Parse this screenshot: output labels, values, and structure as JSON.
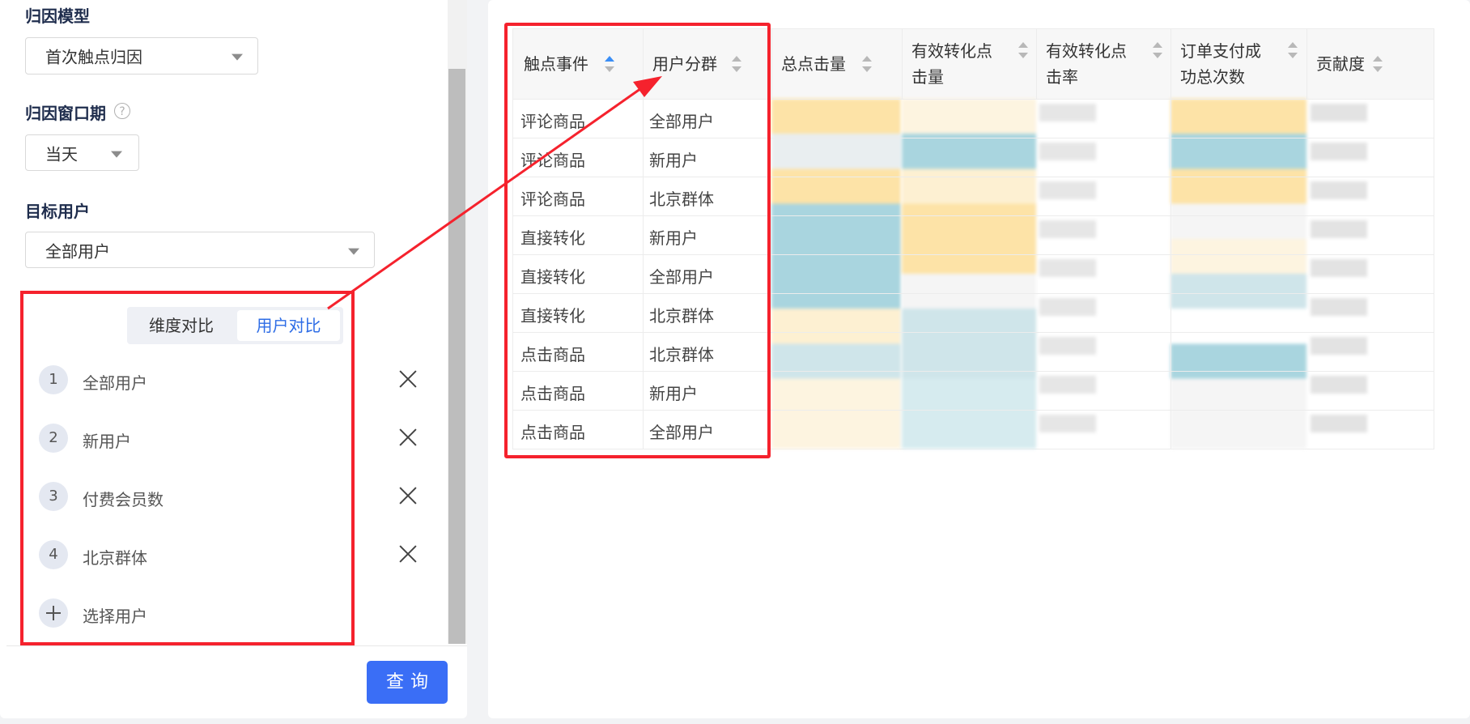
{
  "left": {
    "attribution_model_label": "归因模型",
    "attribution_model_value": "首次触点归因",
    "window_label": "归因窗口期",
    "window_help": "?",
    "window_value": "当天",
    "target_label": "目标用户",
    "target_value": "全部用户",
    "tabs": [
      {
        "label": "维度对比",
        "active": false
      },
      {
        "label": "用户对比",
        "active": true
      }
    ],
    "users": [
      {
        "num": "1",
        "name": "全部用户"
      },
      {
        "num": "2",
        "name": "新用户"
      },
      {
        "num": "3",
        "name": "付费会员数"
      },
      {
        "num": "4",
        "name": "北京群体"
      }
    ],
    "add_user_label": "选择用户",
    "query_button": "查询"
  },
  "table": {
    "columns": [
      {
        "label": "触点事件",
        "sort": "asc"
      },
      {
        "label": "用户分群",
        "sort": "none"
      },
      {
        "label": "总点击量",
        "sort": "none"
      },
      {
        "label": "有效转化点击量",
        "sort": "none"
      },
      {
        "label": "有效转化点击率",
        "sort": "none"
      },
      {
        "label": "订单支付成功总次数",
        "sort": "none"
      },
      {
        "label": "贡献度",
        "sort": "none"
      }
    ],
    "rows": [
      {
        "event": "评论商品",
        "group": "全部用户"
      },
      {
        "event": "评论商品",
        "group": "新用户"
      },
      {
        "event": "评论商品",
        "group": "北京群体"
      },
      {
        "event": "直接转化",
        "group": "新用户"
      },
      {
        "event": "直接转化",
        "group": "全部用户"
      },
      {
        "event": "直接转化",
        "group": "北京群体"
      },
      {
        "event": "点击商品",
        "group": "北京群体"
      },
      {
        "event": "点击商品",
        "group": "新用户"
      },
      {
        "event": "点击商品",
        "group": "全部用户"
      }
    ]
  },
  "colors": {
    "accent": "#3a6ef6",
    "annotation_red": "#f5222d",
    "heat_yellow": "#fde3a7",
    "heat_blue": "#a9d5df"
  }
}
